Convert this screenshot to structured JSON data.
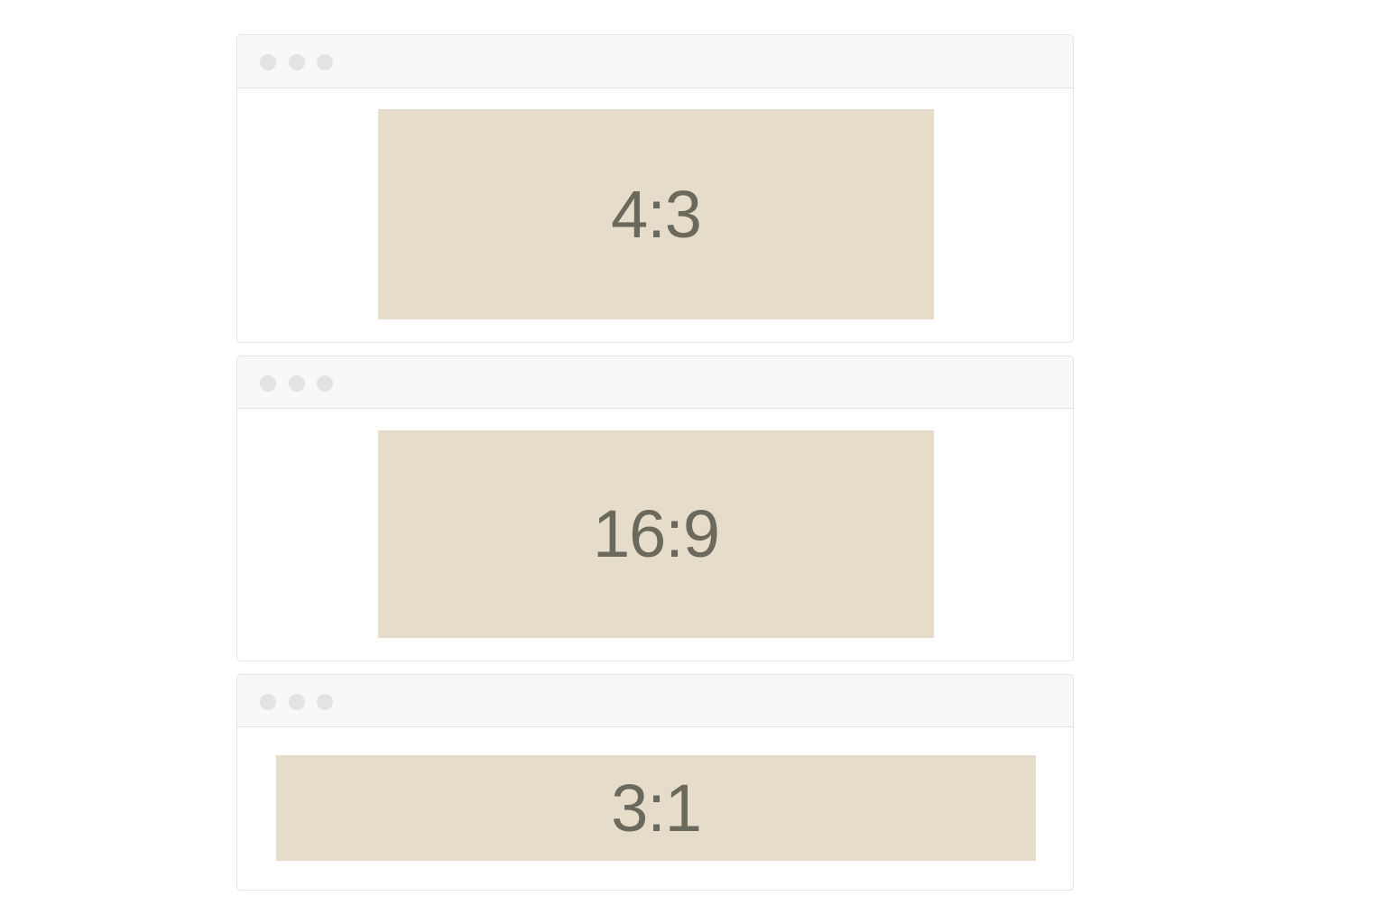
{
  "colors": {
    "panel_fill": "#e5dcca",
    "panel_text": "#6b685c",
    "titlebar": "#f8f8f8",
    "window_border": "#e4e4e4",
    "traffic_dot": "#e3e3e3"
  },
  "windows": [
    {
      "panel_label": "4:3"
    },
    {
      "panel_label": "16:9"
    },
    {
      "panel_label": "3:1"
    }
  ]
}
